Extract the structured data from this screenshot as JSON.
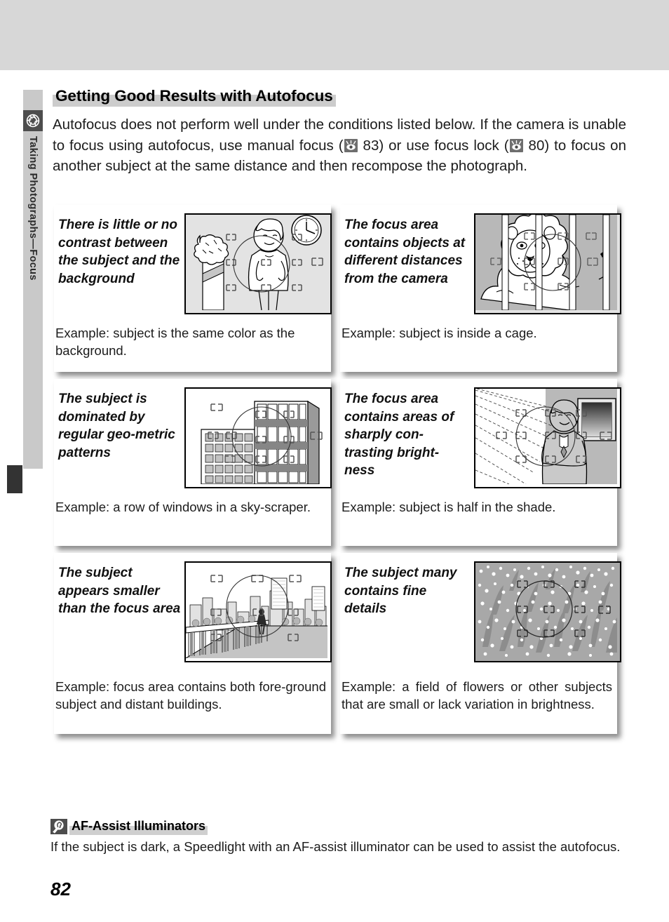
{
  "page": {
    "number": "82",
    "section_icon": "aperture-icon",
    "sidebar_label": "Taking Photographs—Focus"
  },
  "heading": {
    "title": "Getting Good Results with Autofocus"
  },
  "intro": {
    "part1": "Autofocus does not perform well under the conditions listed below.  If the camera is unable to focus using autofocus, use manual focus (",
    "ref1_icon": "eye-reference-icon",
    "ref1_page": "83",
    "part2": ") or use focus lock (",
    "ref2_icon": "eye-reference-icon",
    "ref2_page": "80",
    "part3": ") to focus on another subject at the same distance and then recompose the photograph."
  },
  "examples": [
    {
      "condition": "There is little or no contrast between the subject and the background",
      "example": "Example: subject is the same color as the background.",
      "figure": "woman-tree-clock-figure",
      "justify": false
    },
    {
      "condition": "The focus area contains objects at different distances from the camera",
      "example": "Example: subject is inside a cage.",
      "figure": "lion-behind-bars-figure",
      "justify": false
    },
    {
      "condition": "The subject is dominated by regular geo-metric patterns",
      "example": "Example: a row of windows in a sky-scraper.",
      "figure": "skyscraper-windows-figure",
      "justify": true
    },
    {
      "condition": "The focus area contains areas of sharply con-trasting bright-ness",
      "example": "Example: subject is half in the shade.",
      "figure": "person-half-in-shade-figure",
      "justify": false
    },
    {
      "condition": "The subject appears smaller than the focus area",
      "example": "Example: focus area contains both fore-ground subject and distant buildings.",
      "figure": "cityscape-small-subject-figure",
      "justify": true
    },
    {
      "condition": "The subject many contains fine details",
      "example": "Example: a field of flowers or other subjects that are small or lack variation in brightness.",
      "figure": "field-of-flowers-figure",
      "justify": true
    }
  ],
  "note": {
    "icon": "tip-magnifier-icon",
    "title": "AF-Assist Illuminators",
    "body": "If the subject is dark, a Speedlight with an AF-assist illuminator can be used to assist the autofocus."
  },
  "colors": {
    "band": "#d7d7d7",
    "sidebar": "#c9c9c9",
    "icon_dark": "#4d4d4d",
    "highlight": "#cccccc",
    "figure_bg": "#e3e3e3"
  }
}
